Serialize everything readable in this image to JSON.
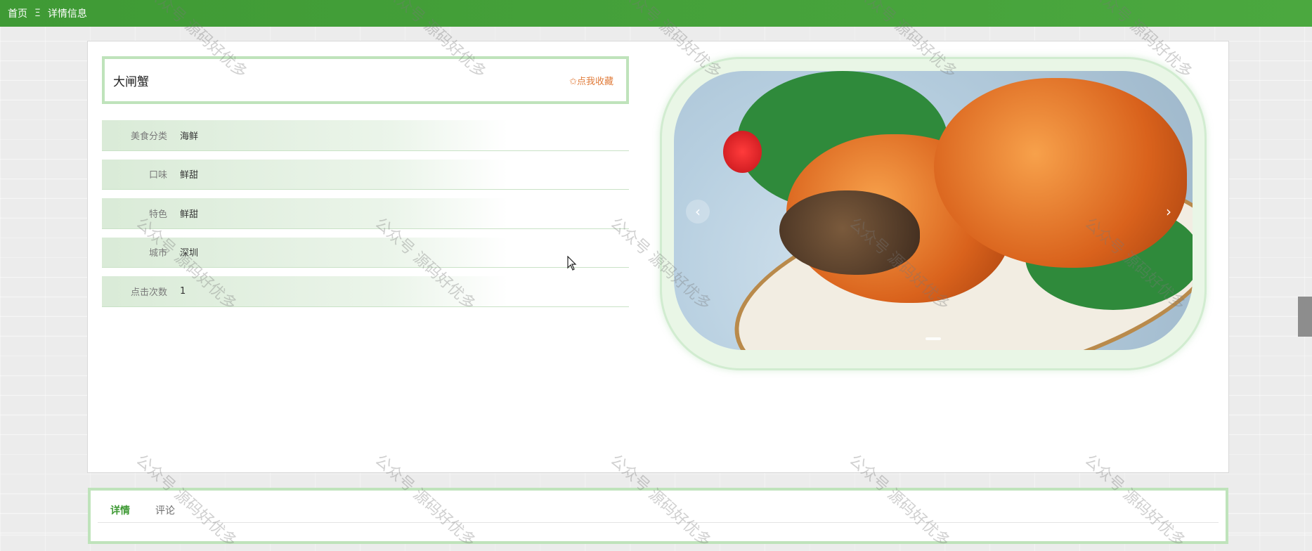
{
  "breadcrumb": {
    "home": "首页",
    "separator": "Ξ",
    "current": "详情信息"
  },
  "detail": {
    "title": "大闸蟹",
    "favorite_label": "✩点我收藏",
    "fields": [
      {
        "label": "美食分类",
        "value": "海鲜"
      },
      {
        "label": "口味",
        "value": "鲜甜"
      },
      {
        "label": "特色",
        "value": "鲜甜"
      },
      {
        "label": "城市",
        "value": "深圳"
      },
      {
        "label": "点击次数",
        "value": "1"
      }
    ]
  },
  "carousel": {
    "prev": "‹",
    "next": "›",
    "slide_count": 1,
    "active_index": 0
  },
  "tabs": [
    {
      "label": "详情",
      "active": true
    },
    {
      "label": "评论",
      "active": false
    }
  ],
  "watermark": "公众号 源码好优多",
  "colors": {
    "primary": "#43a03a",
    "accent": "#e07b39",
    "frame": "#bfe3bb"
  }
}
